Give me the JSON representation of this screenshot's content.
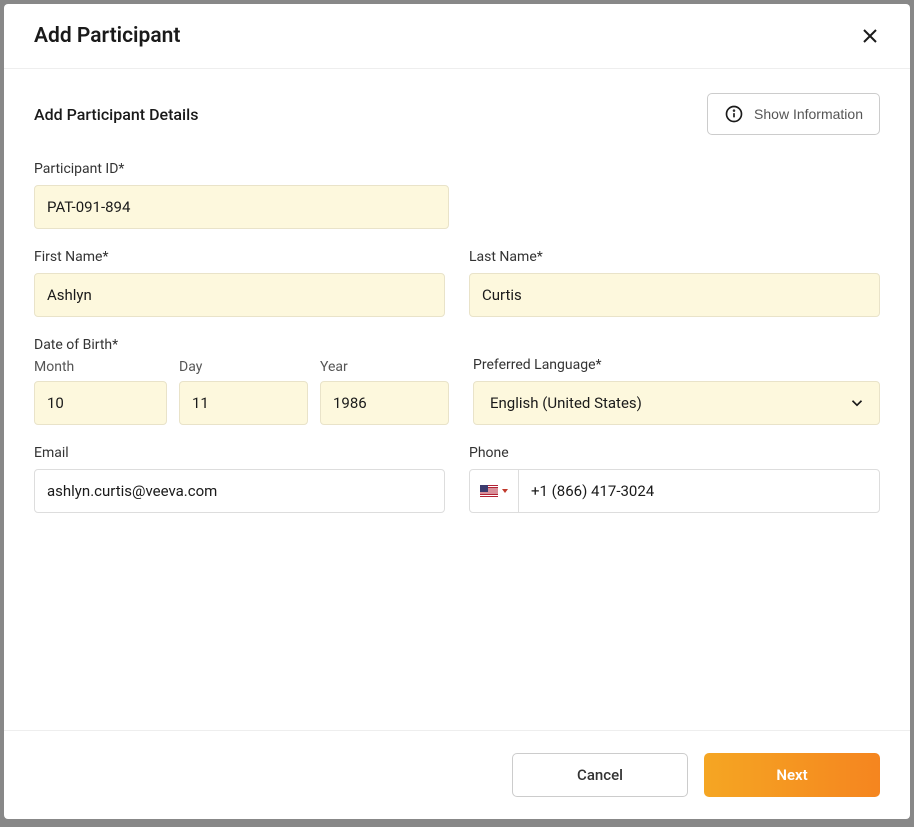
{
  "modal": {
    "title": "Add Participant"
  },
  "section": {
    "title": "Add Participant Details",
    "show_info_label": "Show Information"
  },
  "labels": {
    "participant_id": "Participant ID*",
    "first_name": "First Name*",
    "last_name": "Last Name*",
    "dob": "Date of Birth*",
    "month": "Month",
    "day": "Day",
    "year": "Year",
    "preferred_language": "Preferred Language*",
    "email": "Email",
    "phone": "Phone"
  },
  "values": {
    "participant_id": "PAT-091-894",
    "first_name": "Ashlyn",
    "last_name": "Curtis",
    "month": "10",
    "day": "11",
    "year": "1986",
    "preferred_language": "English (United States)",
    "email": "ashlyn.curtis@veeva.com",
    "phone": "+1 (866) 417-3024"
  },
  "footer": {
    "cancel_label": "Cancel",
    "next_label": "Next"
  }
}
